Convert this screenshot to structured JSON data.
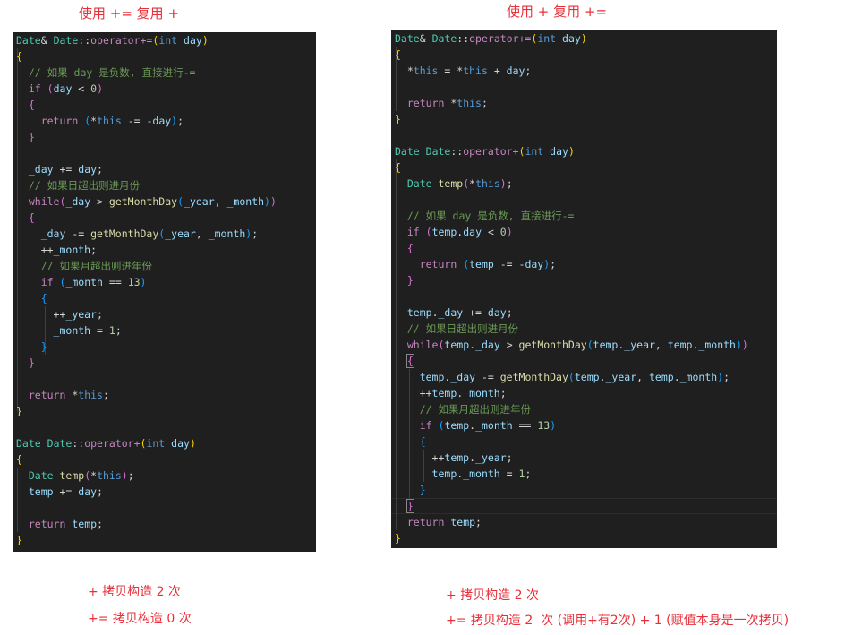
{
  "left": {
    "title": "使用 += 复用 +",
    "notes": [
      "+ 拷贝构造 2 次",
      "+= 拷贝构造 0 次"
    ],
    "code": [
      [
        [
          "ty",
          "Date"
        ],
        [
          "pl",
          "& "
        ],
        [
          "ty",
          "Date"
        ],
        [
          "pl",
          "::"
        ],
        [
          "kw",
          "operator+="
        ],
        [
          "b1",
          "("
        ],
        [
          "kb",
          "int"
        ],
        [
          "pl",
          " "
        ],
        [
          "va",
          "day"
        ],
        [
          "b1",
          ")"
        ]
      ],
      [
        [
          "b1",
          "{"
        ]
      ],
      [
        [
          "pl",
          "  "
        ],
        [
          "cm",
          "// 如果 day 是负数, 直接进行-="
        ]
      ],
      [
        [
          "pl",
          "  "
        ],
        [
          "kw",
          "if"
        ],
        [
          "pl",
          " "
        ],
        [
          "b2",
          "("
        ],
        [
          "va",
          "day"
        ],
        [
          "pl",
          " < "
        ],
        [
          "nu",
          "0"
        ],
        [
          "b2",
          ")"
        ]
      ],
      [
        [
          "pl",
          "  "
        ],
        [
          "b2",
          "{"
        ]
      ],
      [
        [
          "pl",
          "    "
        ],
        [
          "kw",
          "return"
        ],
        [
          "pl",
          " "
        ],
        [
          "b3",
          "("
        ],
        [
          "pl",
          "*"
        ],
        [
          "kb",
          "this"
        ],
        [
          "pl",
          " -= -"
        ],
        [
          "va",
          "day"
        ],
        [
          "b3",
          ")"
        ],
        [
          "pl",
          ";"
        ]
      ],
      [
        [
          "pl",
          "  "
        ],
        [
          "b2",
          "}"
        ]
      ],
      [],
      [
        [
          "pl",
          "  "
        ],
        [
          "va",
          "_day"
        ],
        [
          "pl",
          " += "
        ],
        [
          "va",
          "day"
        ],
        [
          "pl",
          ";"
        ]
      ],
      [
        [
          "pl",
          "  "
        ],
        [
          "cm",
          "// 如果日超出则进月份"
        ]
      ],
      [
        [
          "pl",
          "  "
        ],
        [
          "kw",
          "while"
        ],
        [
          "b2",
          "("
        ],
        [
          "va",
          "_day"
        ],
        [
          "pl",
          " > "
        ],
        [
          "fn",
          "getMonthDay"
        ],
        [
          "b3",
          "("
        ],
        [
          "va",
          "_year"
        ],
        [
          "pl",
          ", "
        ],
        [
          "va",
          "_month"
        ],
        [
          "b3",
          ")"
        ],
        [
          "b2",
          ")"
        ]
      ],
      [
        [
          "pl",
          "  "
        ],
        [
          "b2",
          "{"
        ]
      ],
      [
        [
          "pl",
          "    "
        ],
        [
          "va",
          "_day"
        ],
        [
          "pl",
          " -= "
        ],
        [
          "fn",
          "getMonthDay"
        ],
        [
          "b3",
          "("
        ],
        [
          "va",
          "_year"
        ],
        [
          "pl",
          ", "
        ],
        [
          "va",
          "_month"
        ],
        [
          "b3",
          ")"
        ],
        [
          "pl",
          ";"
        ]
      ],
      [
        [
          "pl",
          "    ++"
        ],
        [
          "va",
          "_month"
        ],
        [
          "pl",
          ";"
        ]
      ],
      [
        [
          "pl",
          "    "
        ],
        [
          "cm",
          "// 如果月超出则进年份"
        ]
      ],
      [
        [
          "pl",
          "    "
        ],
        [
          "kw",
          "if"
        ],
        [
          "pl",
          " "
        ],
        [
          "b3",
          "("
        ],
        [
          "va",
          "_month"
        ],
        [
          "pl",
          " == "
        ],
        [
          "nu",
          "13"
        ],
        [
          "b3",
          ")"
        ]
      ],
      [
        [
          "pl",
          "    "
        ],
        [
          "b3",
          "{"
        ]
      ],
      [
        [
          "pl",
          "      ++"
        ],
        [
          "va",
          "_year"
        ],
        [
          "pl",
          ";"
        ]
      ],
      [
        [
          "pl",
          "      "
        ],
        [
          "va",
          "_month"
        ],
        [
          "pl",
          " = "
        ],
        [
          "nu",
          "1"
        ],
        [
          "pl",
          ";"
        ]
      ],
      [
        [
          "pl",
          "    "
        ],
        [
          "b3",
          "}"
        ]
      ],
      [
        [
          "pl",
          "  "
        ],
        [
          "b2",
          "}"
        ]
      ],
      [],
      [
        [
          "pl",
          "  "
        ],
        [
          "kw",
          "return"
        ],
        [
          "pl",
          " *"
        ],
        [
          "kb",
          "this"
        ],
        [
          "pl",
          ";"
        ]
      ],
      [
        [
          "b1",
          "}"
        ]
      ],
      [],
      [
        [
          "ty",
          "Date"
        ],
        [
          "pl",
          " "
        ],
        [
          "ty",
          "Date"
        ],
        [
          "pl",
          "::"
        ],
        [
          "kw",
          "operator+"
        ],
        [
          "b1",
          "("
        ],
        [
          "kb",
          "int"
        ],
        [
          "pl",
          " "
        ],
        [
          "va",
          "day"
        ],
        [
          "b1",
          ")"
        ]
      ],
      [
        [
          "b1",
          "{"
        ]
      ],
      [
        [
          "pl",
          "  "
        ],
        [
          "ty",
          "Date"
        ],
        [
          "pl",
          " "
        ],
        [
          "fn",
          "temp"
        ],
        [
          "b2",
          "("
        ],
        [
          "pl",
          "*"
        ],
        [
          "kb",
          "this"
        ],
        [
          "b2",
          ")"
        ],
        [
          "pl",
          ";"
        ]
      ],
      [
        [
          "pl",
          "  "
        ],
        [
          "va",
          "temp"
        ],
        [
          "pl",
          " += "
        ],
        [
          "va",
          "day"
        ],
        [
          "pl",
          ";"
        ]
      ],
      [],
      [
        [
          "pl",
          "  "
        ],
        [
          "kw",
          "return"
        ],
        [
          "pl",
          " "
        ],
        [
          "va",
          "temp"
        ],
        [
          "pl",
          ";"
        ]
      ],
      [
        [
          "b1",
          "}"
        ]
      ]
    ]
  },
  "right": {
    "title": "使用 + 复用 +=",
    "notes": [
      "+ 拷贝构造 2 次",
      "+= 拷贝构造 2  次 (调用+有2次) + 1 (赋值本身是一次拷贝)"
    ],
    "code": [
      [
        [
          "ty",
          "Date"
        ],
        [
          "pl",
          "& "
        ],
        [
          "ty",
          "Date"
        ],
        [
          "pl",
          "::"
        ],
        [
          "kw",
          "operator+="
        ],
        [
          "b1",
          "("
        ],
        [
          "kb",
          "int"
        ],
        [
          "pl",
          " "
        ],
        [
          "va",
          "day"
        ],
        [
          "b1",
          ")"
        ]
      ],
      [
        [
          "b1",
          "{"
        ]
      ],
      [
        [
          "pl",
          "  *"
        ],
        [
          "kb",
          "this"
        ],
        [
          "pl",
          " = *"
        ],
        [
          "kb",
          "this"
        ],
        [
          "pl",
          " + "
        ],
        [
          "va",
          "day"
        ],
        [
          "pl",
          ";"
        ]
      ],
      [],
      [
        [
          "pl",
          "  "
        ],
        [
          "kw",
          "return"
        ],
        [
          "pl",
          " *"
        ],
        [
          "kb",
          "this"
        ],
        [
          "pl",
          ";"
        ]
      ],
      [
        [
          "b1",
          "}"
        ]
      ],
      [],
      [
        [
          "ty",
          "Date"
        ],
        [
          "pl",
          " "
        ],
        [
          "ty",
          "Date"
        ],
        [
          "pl",
          "::"
        ],
        [
          "kw",
          "operator+"
        ],
        [
          "b1",
          "("
        ],
        [
          "kb",
          "int"
        ],
        [
          "pl",
          " "
        ],
        [
          "va",
          "day"
        ],
        [
          "b1",
          ")"
        ]
      ],
      [
        [
          "b1",
          "{"
        ]
      ],
      [
        [
          "pl",
          "  "
        ],
        [
          "ty",
          "Date"
        ],
        [
          "pl",
          " "
        ],
        [
          "fn",
          "temp"
        ],
        [
          "b2",
          "("
        ],
        [
          "pl",
          "*"
        ],
        [
          "kb",
          "this"
        ],
        [
          "b2",
          ")"
        ],
        [
          "pl",
          ";"
        ]
      ],
      [],
      [
        [
          "pl",
          "  "
        ],
        [
          "cm",
          "// 如果 day 是负数, 直接进行-="
        ]
      ],
      [
        [
          "pl",
          "  "
        ],
        [
          "kw",
          "if"
        ],
        [
          "pl",
          " "
        ],
        [
          "b2",
          "("
        ],
        [
          "va",
          "temp"
        ],
        [
          "pl",
          "."
        ],
        [
          "va",
          "day"
        ],
        [
          "pl",
          " < "
        ],
        [
          "nu",
          "0"
        ],
        [
          "b2",
          ")"
        ]
      ],
      [
        [
          "pl",
          "  "
        ],
        [
          "b2",
          "{"
        ]
      ],
      [
        [
          "pl",
          "    "
        ],
        [
          "kw",
          "return"
        ],
        [
          "pl",
          " "
        ],
        [
          "b3",
          "("
        ],
        [
          "va",
          "temp"
        ],
        [
          "pl",
          " -= -"
        ],
        [
          "va",
          "day"
        ],
        [
          "b3",
          ")"
        ],
        [
          "pl",
          ";"
        ]
      ],
      [
        [
          "pl",
          "  "
        ],
        [
          "b2",
          "}"
        ]
      ],
      [],
      [
        [
          "pl",
          "  "
        ],
        [
          "va",
          "temp"
        ],
        [
          "pl",
          "."
        ],
        [
          "va",
          "_day"
        ],
        [
          "pl",
          " += "
        ],
        [
          "va",
          "day"
        ],
        [
          "pl",
          ";"
        ]
      ],
      [
        [
          "pl",
          "  "
        ],
        [
          "cm",
          "// 如果日超出则进月份"
        ]
      ],
      [
        [
          "pl",
          "  "
        ],
        [
          "kw",
          "while"
        ],
        [
          "b2",
          "("
        ],
        [
          "va",
          "temp"
        ],
        [
          "pl",
          "."
        ],
        [
          "va",
          "_day"
        ],
        [
          "pl",
          " > "
        ],
        [
          "fn",
          "getMonthDay"
        ],
        [
          "b3",
          "("
        ],
        [
          "va",
          "temp"
        ],
        [
          "pl",
          "."
        ],
        [
          "va",
          "_year"
        ],
        [
          "pl",
          ", "
        ],
        [
          "va",
          "temp"
        ],
        [
          "pl",
          "."
        ],
        [
          "va",
          "_month"
        ],
        [
          "b3",
          ")"
        ],
        [
          "b2",
          ")"
        ]
      ],
      [
        [
          "pl",
          "  "
        ],
        [
          "b2box",
          "{"
        ]
      ],
      [
        [
          "pl",
          "    "
        ],
        [
          "va",
          "temp"
        ],
        [
          "pl",
          "."
        ],
        [
          "va",
          "_day"
        ],
        [
          "pl",
          " -= "
        ],
        [
          "fn",
          "getMonthDay"
        ],
        [
          "b3",
          "("
        ],
        [
          "va",
          "temp"
        ],
        [
          "pl",
          "."
        ],
        [
          "va",
          "_year"
        ],
        [
          "pl",
          ", "
        ],
        [
          "va",
          "temp"
        ],
        [
          "pl",
          "."
        ],
        [
          "va",
          "_month"
        ],
        [
          "b3",
          ")"
        ],
        [
          "pl",
          ";"
        ]
      ],
      [
        [
          "pl",
          "    ++"
        ],
        [
          "va",
          "temp"
        ],
        [
          "pl",
          "."
        ],
        [
          "va",
          "_month"
        ],
        [
          "pl",
          ";"
        ]
      ],
      [
        [
          "pl",
          "    "
        ],
        [
          "cm",
          "// 如果月超出则进年份"
        ]
      ],
      [
        [
          "pl",
          "    "
        ],
        [
          "kw",
          "if"
        ],
        [
          "pl",
          " "
        ],
        [
          "b3",
          "("
        ],
        [
          "va",
          "temp"
        ],
        [
          "pl",
          "."
        ],
        [
          "va",
          "_month"
        ],
        [
          "pl",
          " == "
        ],
        [
          "nu",
          "13"
        ],
        [
          "b3",
          ")"
        ]
      ],
      [
        [
          "pl",
          "    "
        ],
        [
          "b3",
          "{"
        ]
      ],
      [
        [
          "pl",
          "      ++"
        ],
        [
          "va",
          "temp"
        ],
        [
          "pl",
          "."
        ],
        [
          "va",
          "_year"
        ],
        [
          "pl",
          ";"
        ]
      ],
      [
        [
          "pl",
          "      "
        ],
        [
          "va",
          "temp"
        ],
        [
          "pl",
          "."
        ],
        [
          "va",
          "_month"
        ],
        [
          "pl",
          " = "
        ],
        [
          "nu",
          "1"
        ],
        [
          "pl",
          ";"
        ]
      ],
      [
        [
          "pl",
          "    "
        ],
        [
          "b3",
          "}"
        ]
      ],
      [
        [
          "pl",
          "  "
        ],
        [
          "b2box",
          "}"
        ]
      ],
      [
        [
          "pl",
          "  "
        ],
        [
          "kw",
          "return"
        ],
        [
          "pl",
          " "
        ],
        [
          "va",
          "temp"
        ],
        [
          "pl",
          ";"
        ]
      ],
      [
        [
          "b1",
          "}"
        ]
      ]
    ]
  }
}
